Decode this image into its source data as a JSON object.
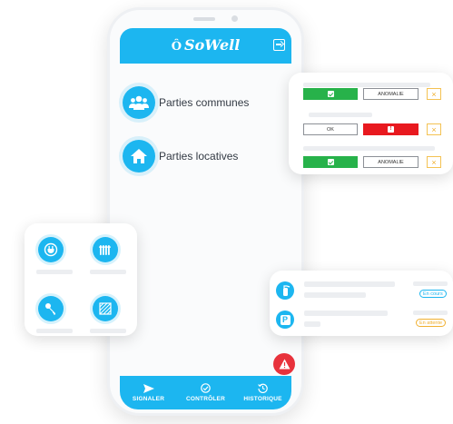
{
  "app": {
    "logo": "SoWell",
    "logo_mark": "Ô"
  },
  "categories": [
    {
      "label": "Parties communes",
      "icon": "people-icon"
    },
    {
      "label": "Parties locatives",
      "icon": "home-icon"
    }
  ],
  "tabbar": [
    {
      "label": "SIGNALER",
      "icon": "send-icon"
    },
    {
      "label": "CONTRÔLER",
      "icon": "check-circle-icon"
    },
    {
      "label": "HISTORIQUE",
      "icon": "history-icon"
    }
  ],
  "control_card": {
    "rows": [
      {
        "left": "check",
        "anomaly_label": "ANOMALIE"
      },
      {
        "ok_label": "OK",
        "right": "alert"
      },
      {
        "left": "check",
        "anomaly_label": "ANOMALIE"
      }
    ],
    "close_symbol": "×"
  },
  "status_card": {
    "items": [
      {
        "icon": "extinguisher-icon",
        "status": "En cours",
        "status_color": "#1cb6f0"
      },
      {
        "icon": "parking-icon",
        "icon_text": "P",
        "status": "En attente",
        "status_color": "#f0b030"
      }
    ]
  },
  "icons_card": [
    "plug-icon",
    "radiator-icon",
    "key-icon",
    "floor-icon"
  ],
  "colors": {
    "accent": "#1cb6f0",
    "green": "#27b24a",
    "red": "#e8191f",
    "alert": "#e8323c",
    "warning": "#f0b030"
  }
}
